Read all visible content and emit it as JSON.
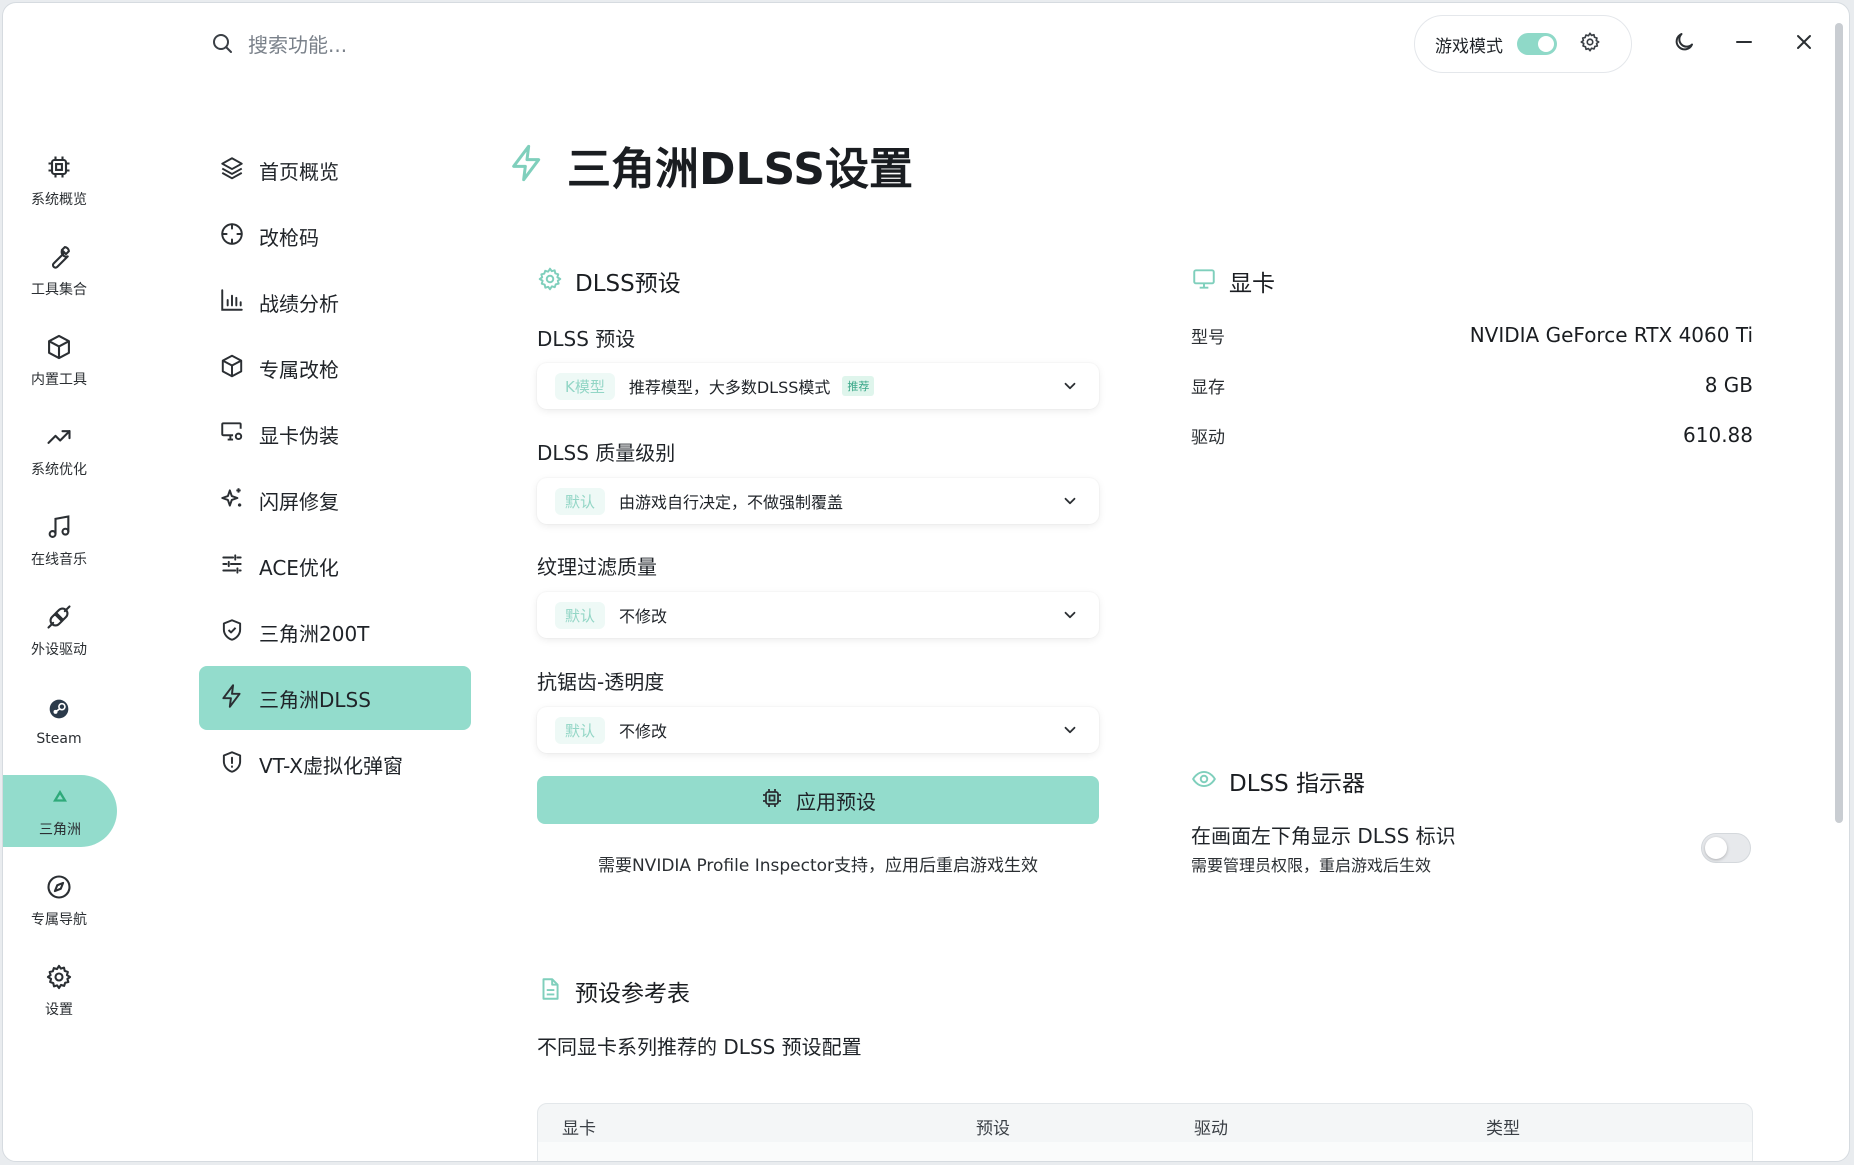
{
  "search": {
    "placeholder": "搜索功能..."
  },
  "header": {
    "game_mode_label": "游戏模式"
  },
  "rail": {
    "items": [
      {
        "label": "系统概览",
        "icon": "cpu-icon"
      },
      {
        "label": "工具集合",
        "icon": "wrench-icon"
      },
      {
        "label": "内置工具",
        "icon": "box-icon"
      },
      {
        "label": "系统优化",
        "icon": "trending-up-icon"
      },
      {
        "label": "在线音乐",
        "icon": "music-icon"
      },
      {
        "label": "外设驱动",
        "icon": "plug-icon"
      },
      {
        "label": "Steam",
        "icon": "steam-icon"
      },
      {
        "label": "三角洲",
        "icon": "triangle-icon"
      },
      {
        "label": "专属导航",
        "icon": "compass-icon"
      },
      {
        "label": "设置",
        "icon": "gear-icon"
      }
    ],
    "active_index": 7
  },
  "subnav": {
    "items": [
      {
        "label": "首页概览",
        "icon": "layers-icon"
      },
      {
        "label": "改枪码",
        "icon": "crosshair-icon"
      },
      {
        "label": "战绩分析",
        "icon": "bar-chart-icon"
      },
      {
        "label": "专属改枪",
        "icon": "box-icon"
      },
      {
        "label": "显卡伪装",
        "icon": "monitor-gear-icon"
      },
      {
        "label": "闪屏修复",
        "icon": "sparkles-icon"
      },
      {
        "label": "ACE优化",
        "icon": "sliders-icon"
      },
      {
        "label": "三角洲200T",
        "icon": "shield-check-icon"
      },
      {
        "label": "三角洲DLSS",
        "icon": "bolt-icon"
      },
      {
        "label": "VT-X虚拟化弹窗",
        "icon": "shield-alert-icon"
      }
    ],
    "active_index": 8
  },
  "page": {
    "title": "三角洲DLSS设置"
  },
  "dlss_preset": {
    "section_title": "DLSS预设",
    "fields": [
      {
        "label": "DLSS 预设",
        "tag": "K模型",
        "value": "推荐模型，大多数DLSS模式",
        "badge": "推荐"
      },
      {
        "label": "DLSS 质量级别",
        "tag": "默认",
        "value": "由游戏自行决定，不做强制覆盖"
      },
      {
        "label": "纹理过滤质量",
        "tag": "默认",
        "value": "不修改"
      },
      {
        "label": "抗锯齿-透明度",
        "tag": "默认",
        "value": "不修改"
      }
    ],
    "apply_label": "应用预设",
    "apply_hint": "需要NVIDIA Profile Inspector支持，应用后重启游戏生效"
  },
  "gpu": {
    "section_title": "显卡",
    "rows": [
      {
        "key": "型号",
        "value": "NVIDIA GeForce RTX 4060 Ti"
      },
      {
        "key": "显存",
        "value": "8 GB"
      },
      {
        "key": "驱动",
        "value": "610.88"
      }
    ]
  },
  "indicator": {
    "section_title": "DLSS 指示器",
    "title": "在画面左下角显示 DLSS 标识",
    "subtitle": "需要管理员权限，重启游戏后生效",
    "enabled": false
  },
  "reference": {
    "section_title": "预设参考表",
    "description": "不同显卡系列推荐的 DLSS 预设配置",
    "columns": [
      "显卡",
      "预设",
      "驱动",
      "类型"
    ]
  },
  "colors": {
    "accent": "#93dccc",
    "accent_icon": "#7fcfbc",
    "text": "#1f2328"
  }
}
